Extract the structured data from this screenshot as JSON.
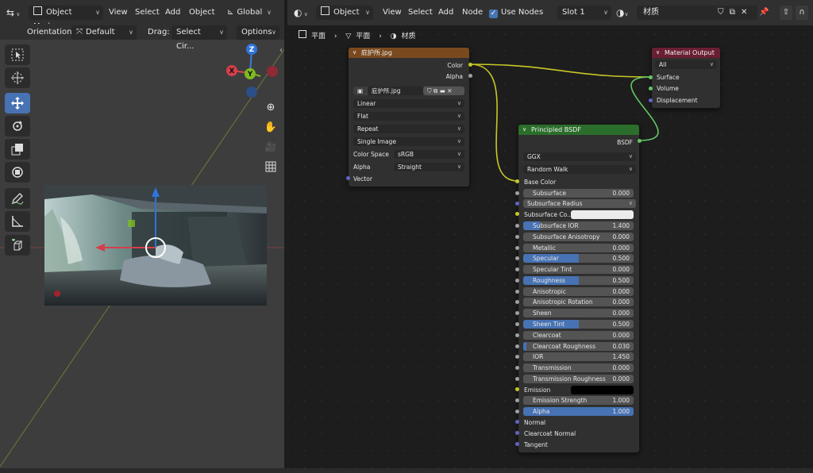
{
  "viewport": {
    "header": {
      "mode": "Object Mode",
      "menus": [
        "View",
        "Select",
        "Add",
        "Object"
      ],
      "transform_orientation": "Global"
    },
    "subheader": {
      "orientation_label": "Orientation:",
      "orientation_value": "Default",
      "drag_label": "Drag:",
      "drag_value": "Select Cir...",
      "options": "Options"
    },
    "gizmo": {
      "z": "Z",
      "y": "Y",
      "x": "X"
    }
  },
  "node_editor": {
    "header": {
      "type": "Object",
      "menus": [
        "View",
        "Select",
        "Add",
        "Node"
      ],
      "use_nodes_label": "Use Nodes",
      "slot": "Slot 1",
      "material_name": "材质"
    },
    "breadcrumb": [
      "平面",
      "平面",
      "材质"
    ],
    "image_node": {
      "title": "庇护所.jpg",
      "outputs": [
        "Color",
        "Alpha"
      ],
      "image_name": "庇护所.jpg",
      "interpolation": "Linear",
      "projection": "Flat",
      "extension": "Repeat",
      "source": "Single Image",
      "color_space_label": "Color Space",
      "color_space": "sRGB",
      "alpha_label": "Alpha",
      "alpha": "Straight",
      "input": "Vector"
    },
    "output_node": {
      "title": "Material Output",
      "target": "All",
      "inputs": [
        "Surface",
        "Volume",
        "Displacement"
      ]
    },
    "bsdf_node": {
      "title": "Principled BSDF",
      "output": "BSDF",
      "distribution": "GGX",
      "subsurface_method": "Random Walk",
      "base_color_label": "Base Color",
      "subsurface_radius_label": "Subsurface Radius",
      "subsurface_color_label": "Subsurface Co...",
      "emission_label": "Emission",
      "params": [
        {
          "label": "Subsurface",
          "value": "0.000",
          "fill": 0.0
        },
        {
          "label": "Subsurface IOR",
          "value": "1.400",
          "fill": 0.15
        },
        {
          "label": "Subsurface Anisotropy",
          "value": "0.000",
          "fill": 0.0
        },
        {
          "label": "Metallic",
          "value": "0.000",
          "fill": 0.0
        },
        {
          "label": "Specular",
          "value": "0.500",
          "fill": 0.5
        },
        {
          "label": "Specular Tint",
          "value": "0.000",
          "fill": 0.0
        },
        {
          "label": "Roughness",
          "value": "0.500",
          "fill": 0.5
        },
        {
          "label": "Anisotropic",
          "value": "0.000",
          "fill": 0.0
        },
        {
          "label": "Anisotropic Rotation",
          "value": "0.000",
          "fill": 0.0
        },
        {
          "label": "Sheen",
          "value": "0.000",
          "fill": 0.0
        },
        {
          "label": "Sheen Tint",
          "value": "0.500",
          "fill": 0.5
        },
        {
          "label": "Clearcoat",
          "value": "0.000",
          "fill": 0.0
        },
        {
          "label": "Clearcoat Roughness",
          "value": "0.030",
          "fill": 0.03
        },
        {
          "label": "IOR",
          "value": "1.450",
          "fill": 0.0
        },
        {
          "label": "Transmission",
          "value": "0.000",
          "fill": 0.0
        },
        {
          "label": "Transmission Roughness",
          "value": "0.000",
          "fill": 0.0
        }
      ],
      "emission_strength": {
        "label": "Emission Strength",
        "value": "1.000",
        "fill": 0.0
      },
      "alpha": {
        "label": "Alpha",
        "value": "1.000",
        "fill": 1.0
      },
      "inputs_bottom": [
        "Normal",
        "Clearcoat Normal",
        "Tangent"
      ]
    }
  },
  "colors": {
    "accent": "#4772b3",
    "image_node_header": "#7a4a1e",
    "bsdf_node_header": "#2b6e2b",
    "output_node_header": "#6b1f33",
    "socket_yellow": "#c7c729",
    "socket_gray": "#a1a1a1",
    "socket_green": "#63c763",
    "socket_blue": "#6363c7"
  }
}
